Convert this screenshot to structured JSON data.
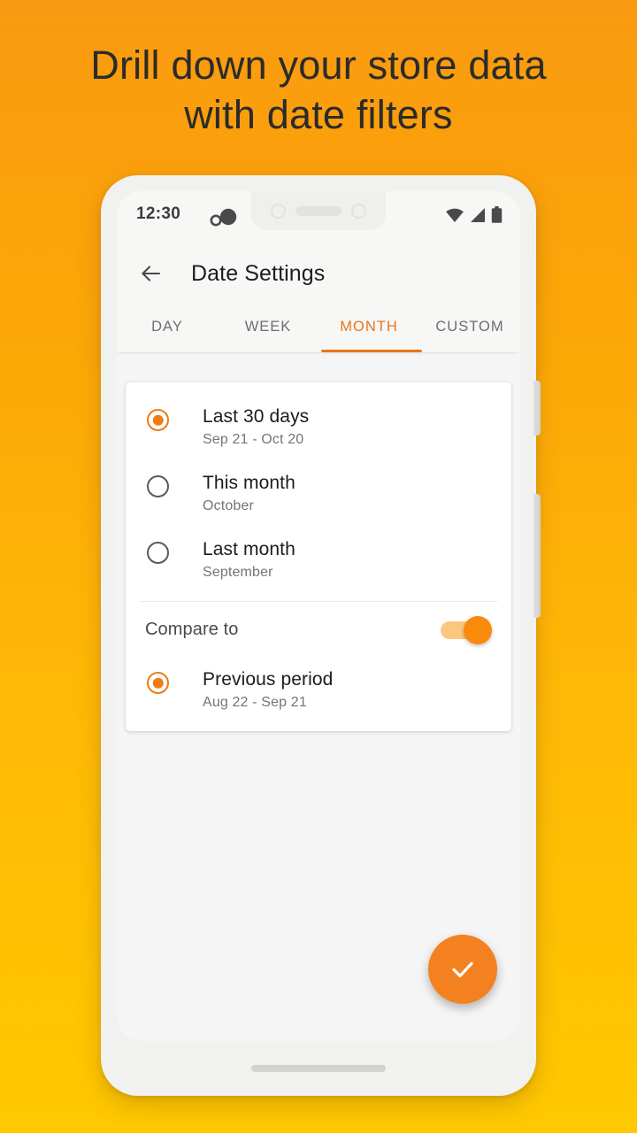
{
  "headline": "Drill down your store data\nwith date filters",
  "phone": {
    "status_bar": {
      "time": "12:30",
      "notification_icon": "notification-dots-icon",
      "wifi_icon": "wifi-icon",
      "signal_icon": "cellular-signal-icon",
      "battery_icon": "battery-full-icon"
    },
    "app_bar": {
      "back_icon": "back-arrow-icon",
      "title": "Date Settings"
    },
    "tabs": {
      "items": [
        {
          "label": "DAY",
          "active": false
        },
        {
          "label": "WEEK",
          "active": false
        },
        {
          "label": "MONTH",
          "active": true
        },
        {
          "label": "CUSTOM",
          "active": false
        }
      ],
      "active_index": 2,
      "indicator_color": "#E8761A"
    },
    "card": {
      "options": [
        {
          "title": "Last 30 days",
          "subtitle": "Sep 21 - Oct 20",
          "selected": true
        },
        {
          "title": "This month",
          "subtitle": "October",
          "selected": false
        },
        {
          "title": "Last month",
          "subtitle": "September",
          "selected": false
        }
      ],
      "compare": {
        "label": "Compare to",
        "toggle_on": true,
        "toggle_track_color": "#FAC77E",
        "toggle_thumb_color": "#F98A0C",
        "option": {
          "title": "Previous period",
          "subtitle": "Aug 22 - Sep 21",
          "selected": true
        }
      }
    },
    "fab": {
      "icon": "check-icon",
      "color": "#F4811F"
    },
    "home_indicator": "home-indicator-bar"
  },
  "colors": {
    "background_top": "#FA9A10",
    "background_bottom": "#FFC800",
    "accent": "#F07B17",
    "screen_bg": "#F5F5F5",
    "card_bg": "#FFFFFF"
  }
}
